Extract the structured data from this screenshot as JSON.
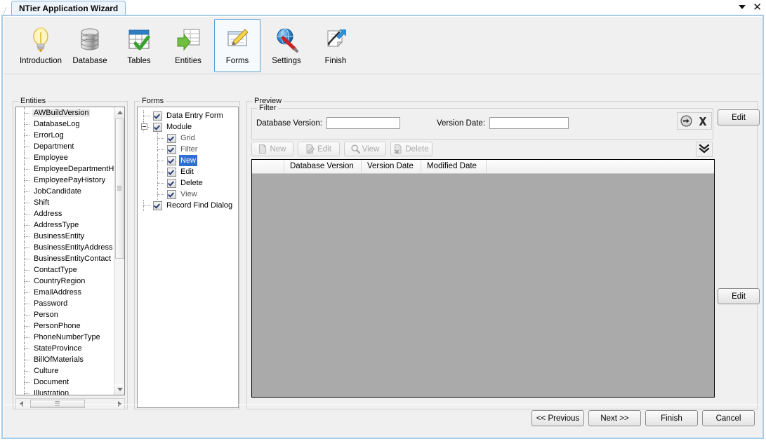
{
  "window": {
    "tab_title": "NTier Application Wizard",
    "caret_icon": "chevron-down-icon",
    "close_icon": "close-icon"
  },
  "toolbar": {
    "steps": [
      {
        "label": "Introduction",
        "icon": "lightbulb-icon",
        "selected": false
      },
      {
        "label": "Database",
        "icon": "database-icon",
        "selected": false
      },
      {
        "label": "Tables",
        "icon": "table-check-icon",
        "selected": false
      },
      {
        "label": "Entities",
        "icon": "entities-arrow-icon",
        "selected": false
      },
      {
        "label": "Forms",
        "icon": "form-pencil-icon",
        "selected": true
      },
      {
        "label": "Settings",
        "icon": "globe-wrench-icon",
        "selected": false
      },
      {
        "label": "Finish",
        "icon": "finish-arrow-icon",
        "selected": false
      }
    ]
  },
  "entities": {
    "title": "Entities",
    "selected": "AWBuildVersion",
    "items": [
      "AWBuildVersion",
      "DatabaseLog",
      "ErrorLog",
      "Department",
      "Employee",
      "EmployeeDepartmentHist",
      "EmployeePayHistory",
      "JobCandidate",
      "Shift",
      "Address",
      "AddressType",
      "BusinessEntity",
      "BusinessEntityAddress",
      "BusinessEntityContact",
      "ContactType",
      "CountryRegion",
      "EmailAddress",
      "Password",
      "Person",
      "PersonPhone",
      "PhoneNumberType",
      "StateProvince",
      "BillOfMaterials",
      "Culture",
      "Document",
      "Illustration"
    ],
    "scroll_up_icon": "scroll-up-arrow-icon",
    "scroll_down_icon": "scroll-down-arrow-icon",
    "scroll_left_icon": "scroll-left-arrow-icon",
    "scroll_right_icon": "scroll-right-arrow-icon"
  },
  "forms": {
    "title": "Forms",
    "items": [
      {
        "label": "Data Entry Form",
        "level": 0,
        "checked": true,
        "highlight": false,
        "dim": false,
        "expander": false
      },
      {
        "label": "Module",
        "level": 0,
        "checked": true,
        "highlight": false,
        "dim": false,
        "expander": true
      },
      {
        "label": "Grid",
        "level": 1,
        "checked": true,
        "highlight": false,
        "dim": true,
        "expander": false
      },
      {
        "label": "Filter",
        "level": 1,
        "checked": true,
        "highlight": false,
        "dim": true,
        "expander": false
      },
      {
        "label": "New",
        "level": 1,
        "checked": true,
        "highlight": true,
        "dim": false,
        "expander": false
      },
      {
        "label": "Edit",
        "level": 1,
        "checked": true,
        "highlight": false,
        "dim": false,
        "expander": false
      },
      {
        "label": "Delete",
        "level": 1,
        "checked": true,
        "highlight": false,
        "dim": false,
        "expander": false
      },
      {
        "label": "View",
        "level": 1,
        "checked": true,
        "highlight": false,
        "dim": true,
        "expander": false
      },
      {
        "label": "Record Find Dialog",
        "level": 0,
        "checked": true,
        "highlight": false,
        "dim": false,
        "expander": false
      }
    ]
  },
  "preview": {
    "title": "Preview",
    "filter": {
      "title": "Filter",
      "database_version_label": "Database Version:",
      "database_version_value": "",
      "database_version_placeholder": "",
      "version_date_label": "Version Date:",
      "version_date_value": "",
      "version_date_placeholder": "",
      "apply_icon": "apply-arrow-icon",
      "clear_icon": "clear-x-icon"
    },
    "crud_buttons": [
      {
        "label": "New",
        "icon": "new-page-icon",
        "enabled": false
      },
      {
        "label": "Edit",
        "icon": "edit-page-icon",
        "enabled": false
      },
      {
        "label": "View",
        "icon": "magnifier-icon",
        "enabled": false
      },
      {
        "label": "Delete",
        "icon": "delete-page-icon",
        "enabled": false
      }
    ],
    "expand_icon": "chevrons-down-icon",
    "grid": {
      "columns": [
        "Database Version",
        "Version Date",
        "Modified Date"
      ],
      "rows": []
    }
  },
  "side_buttons": {
    "edit_top_label": "Edit",
    "edit_mid_label": "Edit"
  },
  "footer": {
    "previous_label": "<< Previous",
    "next_label": "Next >>",
    "finish_label": "Finish",
    "cancel_label": "Cancel"
  },
  "colors": {
    "accent": "#5a9fd4",
    "highlight": "#2f6fd0",
    "window_bg": "#f0f0f0",
    "grid_bg": "#aaaaaa"
  }
}
